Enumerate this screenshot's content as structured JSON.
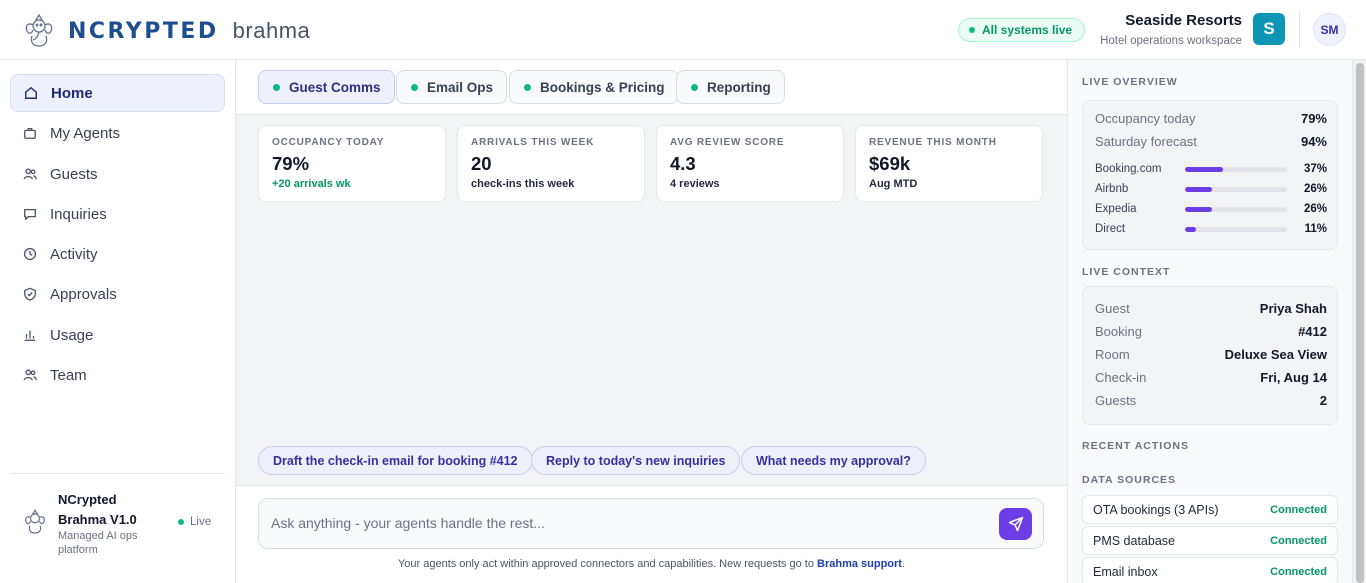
{
  "header": {
    "brand_name": "NCRYPTED",
    "brand_product": "brahma",
    "status": "All systems live",
    "org_name": "Seaside Resorts",
    "org_subtitle": "Hotel operations workspace",
    "org_initial": "S",
    "user_initials": "SM"
  },
  "sidebar": {
    "items": [
      {
        "label": "Home",
        "icon": "home-icon",
        "active": true
      },
      {
        "label": "My Agents",
        "icon": "briefcase-icon"
      },
      {
        "label": "Guests",
        "icon": "users-icon"
      },
      {
        "label": "Inquiries",
        "icon": "chat-bubble-icon"
      },
      {
        "label": "Activity",
        "icon": "clock-icon"
      },
      {
        "label": "Approvals",
        "icon": "shield-check-icon"
      },
      {
        "label": "Usage",
        "icon": "bar-chart-icon"
      },
      {
        "label": "Team",
        "icon": "team-icon"
      }
    ],
    "footer": {
      "title": "NCrypted Brahma V1.0",
      "subtitle": "Managed AI ops platform",
      "status": "Live"
    }
  },
  "tabs": [
    {
      "label": "Guest Comms",
      "active": true
    },
    {
      "label": "Email Ops"
    },
    {
      "label": "Bookings & Pricing"
    },
    {
      "label": "Reporting"
    }
  ],
  "kpis": [
    {
      "label": "OCCUPANCY TODAY",
      "value": "79%",
      "sub": "+20 arrivals wk"
    },
    {
      "label": "ARRIVALS THIS WEEK",
      "value": "20",
      "sub": "check-ins this week"
    },
    {
      "label": "AVG REVIEW SCORE",
      "value": "4.3",
      "sub": "4 reviews"
    },
    {
      "label": "REVENUE THIS MONTH",
      "value": "$69k",
      "sub": "Aug MTD"
    }
  ],
  "suggestions": [
    "Draft the check-in email for booking #412",
    "Reply to today's new inquiries",
    "What needs my approval?"
  ],
  "composer": {
    "placeholder": "Ask anything - your agents handle the rest...",
    "disclaimer": "Your agents only act within approved connectors and capabilities. New requests go to",
    "disclaimer_link": "Brahma support",
    "disclaimer_end": "."
  },
  "right_panel": {
    "live_overview_title": "LIVE OVERVIEW",
    "overview": [
      {
        "k": "Occupancy today",
        "v": "79%"
      },
      {
        "k": "Saturday forecast",
        "v": "94%"
      }
    ],
    "channels": [
      {
        "name": "Booking.com",
        "pct": "37%",
        "value": 37
      },
      {
        "name": "Airbnb",
        "pct": "26%",
        "value": 26
      },
      {
        "name": "Expedia",
        "pct": "26%",
        "value": 26
      },
      {
        "name": "Direct",
        "pct": "11%",
        "value": 11
      }
    ],
    "live_context_title": "LIVE CONTEXT",
    "context": [
      {
        "k": "Guest",
        "v": "Priya Shah"
      },
      {
        "k": "Booking",
        "v": "#412"
      },
      {
        "k": "Room",
        "v": "Deluxe Sea View"
      },
      {
        "k": "Check-in",
        "v": "Fri, Aug 14"
      },
      {
        "k": "Guests",
        "v": "2"
      }
    ],
    "recent_actions_title": "RECENT ACTIONS",
    "data_sources_title": "DATA SOURCES",
    "sources": [
      {
        "name": "OTA bookings (3 APIs)",
        "status": "Connected"
      },
      {
        "name": "PMS database",
        "status": "Connected"
      },
      {
        "name": "Email inbox",
        "status": "Connected"
      }
    ]
  },
  "colors": {
    "accent": "#6d3ee6",
    "brand_blue": "#1d4e8f",
    "live_green": "#10b981",
    "org_avatar": "#0e94b5"
  }
}
